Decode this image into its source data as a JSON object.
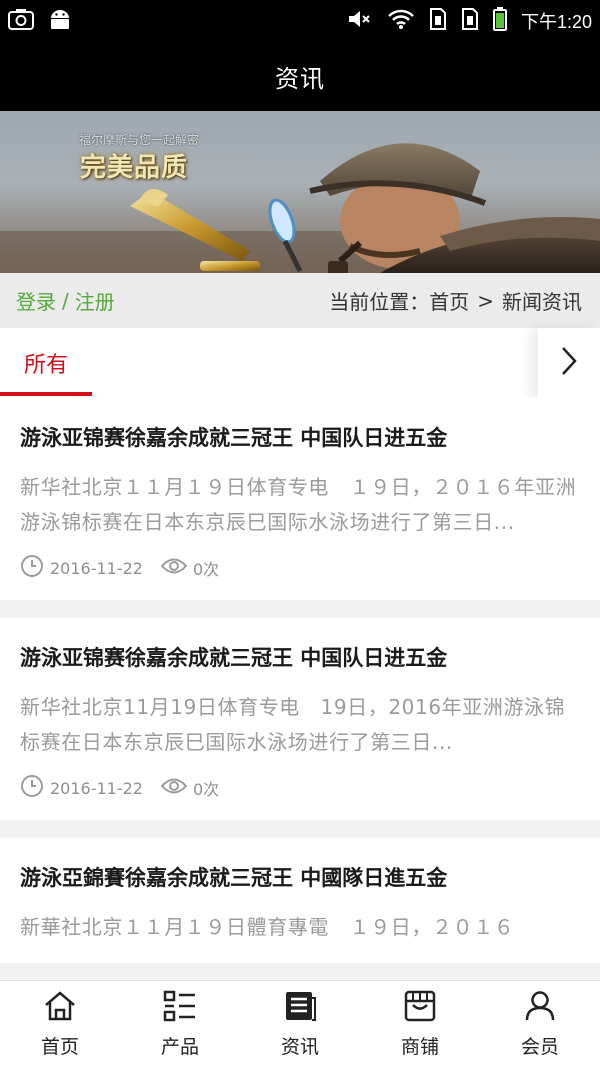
{
  "status_bar": {
    "time": "下午1:20",
    "left_icons": [
      "screenshot-icon",
      "android-icon"
    ],
    "right_icons": [
      "mute-icon",
      "wifi-icon",
      "sim1-icon",
      "sim2-icon",
      "battery-icon"
    ]
  },
  "header": {
    "title": "资讯"
  },
  "banner": {
    "slogan": "福尔摩斯与您一起解密",
    "headline": "完美品质"
  },
  "breadcrumb": {
    "login": "登录",
    "separator": "/",
    "register": "注册",
    "location_label": "当前位置：",
    "home": "首页",
    "arrow": ">",
    "current": "新闻资讯"
  },
  "tabs": {
    "active": "所有",
    "more_icon": "chevron-right-icon"
  },
  "news": [
    {
      "title": "游泳亚锦赛徐嘉余成就三冠王 中国队日进五金",
      "summary": "新华社北京１１月１９日体育专电　１９日，２０１６年亚洲游泳锦标赛在日本东京辰巳国际水泳场进行了第三日...",
      "date": "2016-11-22",
      "views": "0次"
    },
    {
      "title": "游泳亚锦赛徐嘉余成就三冠王 中国队日进五金",
      "summary": "新华社北京11月19日体育专电　19日，2016年亚洲游泳锦标赛在日本东京辰巳国际水泳场进行了第三日...",
      "date": "2016-11-22",
      "views": "0次"
    },
    {
      "title": "游泳亞錦賽徐嘉余成就三冠王 中國隊日進五金",
      "summary": "新華社北京１１月１９日體育專電　１９日，２０１６",
      "date": "",
      "views": ""
    }
  ],
  "bottom_nav": [
    {
      "label": "首页",
      "icon": "home-icon"
    },
    {
      "label": "产品",
      "icon": "grid-list-icon"
    },
    {
      "label": "资讯",
      "icon": "news-icon"
    },
    {
      "label": "商铺",
      "icon": "shop-icon"
    },
    {
      "label": "会员",
      "icon": "user-icon"
    }
  ],
  "colors": {
    "accent_red": "#d0101a",
    "link_green": "#55a93a",
    "summary_gray": "#9b9b9b"
  }
}
